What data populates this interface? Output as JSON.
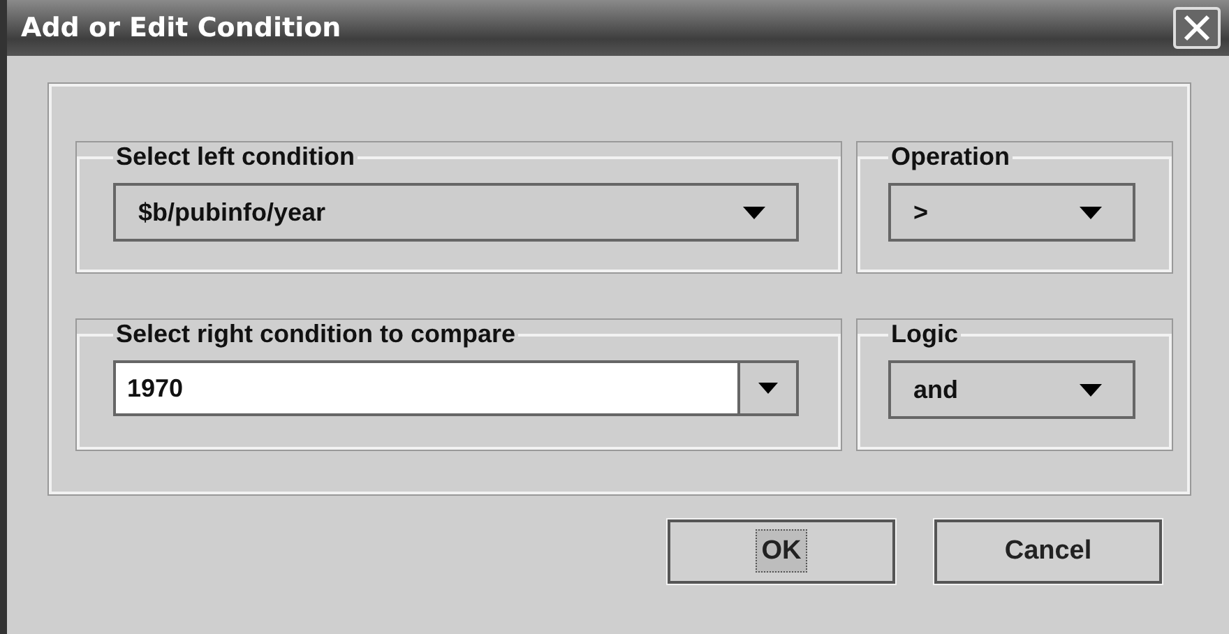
{
  "window": {
    "title": "Add or Edit Condition"
  },
  "groups": [
    {
      "label": "Select left condition",
      "kind": "select",
      "value": "$b/pubinfo/year"
    },
    {
      "label": "Operation",
      "kind": "select",
      "value": ">"
    },
    {
      "label": "Select right condition to compare",
      "kind": "editable",
      "value": "1970"
    },
    {
      "label": "Logic",
      "kind": "select",
      "value": "and"
    }
  ],
  "buttons": [
    {
      "label": "OK",
      "focused": true
    },
    {
      "label": "Cancel",
      "focused": false
    }
  ]
}
